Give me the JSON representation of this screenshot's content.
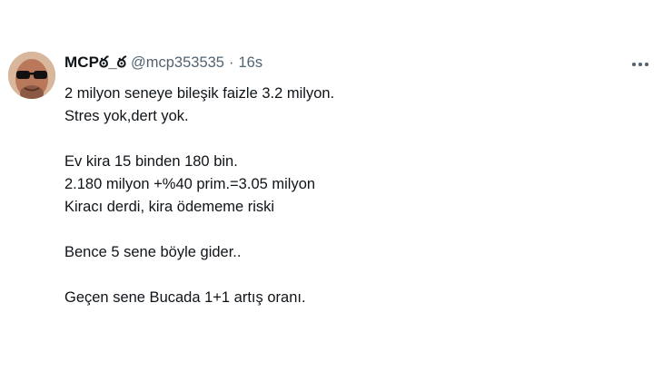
{
  "tweet": {
    "author": {
      "display_name": "MCPఠ_ఠ",
      "handle": "@mcp353535"
    },
    "separator": "·",
    "time": "16s",
    "lines": [
      "2 milyon seneye bileşik faizle 3.2 milyon.",
      "Stres yok,dert yok.",
      "",
      "Ev kira 15 binden 180 bin.",
      "2.180 milyon +%40 prim.=3.05 milyon",
      "Kiracı derdi, kira ödememe riski",
      "",
      "Bence 5 sene böyle gider..",
      "",
      "Geçen sene Bucada 1+1 artış oranı."
    ]
  },
  "icons": {
    "more": "more-horizontal-icon"
  },
  "colors": {
    "text_primary": "#0f1419",
    "text_secondary": "#536471",
    "background": "#ffffff"
  }
}
